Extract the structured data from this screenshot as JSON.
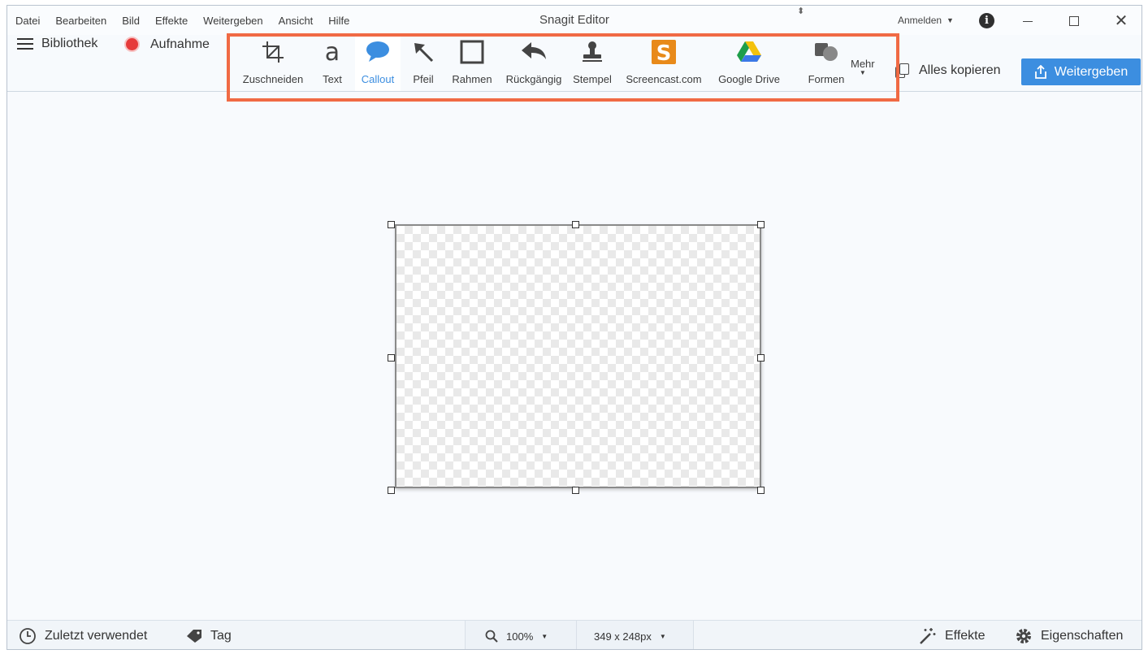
{
  "menubar": {
    "items": [
      "Datei",
      "Bearbeiten",
      "Bild",
      "Effekte",
      "Weitergeben",
      "Ansicht",
      "Hilfe"
    ],
    "title": "Snagit Editor",
    "signin": "Anmelden"
  },
  "toolbar": {
    "library": "Bibliothek",
    "capture": "Aufnahme",
    "tools": [
      {
        "label": "Zuschneiden",
        "icon": "crop-icon"
      },
      {
        "label": "Text",
        "icon": "text-icon"
      },
      {
        "label": "Callout",
        "icon": "callout-icon",
        "active": true
      },
      {
        "label": "Pfeil",
        "icon": "arrow-icon"
      },
      {
        "label": "Rahmen",
        "icon": "rectangle-icon"
      },
      {
        "label": "Rückgängig",
        "icon": "undo-icon"
      },
      {
        "label": "Stempel",
        "icon": "stamp-icon"
      },
      {
        "label": "Screencast.com",
        "icon": "screencast-icon"
      },
      {
        "label": "Google Drive",
        "icon": "google-drive-icon"
      },
      {
        "label": "Formen",
        "icon": "shapes-icon"
      }
    ],
    "more": "Mehr",
    "copy_all": "Alles kopieren",
    "share": "Weitergeben"
  },
  "statusbar": {
    "recent": "Zuletzt verwendet",
    "tag": "Tag",
    "zoom": "100%",
    "dimensions": "349 x 248px",
    "effects": "Effekte",
    "properties": "Eigenschaften"
  },
  "colors": {
    "accent": "#3c8ee0",
    "highlight": "#f06a44",
    "record": "#e63b3b"
  }
}
